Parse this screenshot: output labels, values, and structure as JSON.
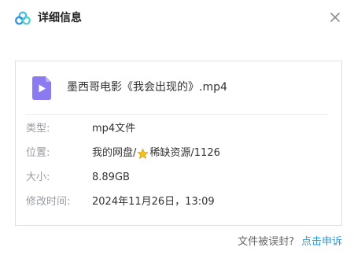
{
  "dialog": {
    "title": "详细信息"
  },
  "file": {
    "name": "墨西哥电影《我会出现的》.mp4",
    "icon": "video-file-icon"
  },
  "details": {
    "type_label": "类型:",
    "type_value": "mp4文件",
    "location_label": "位置:",
    "location_part1": "我的网盘/",
    "location_part2": "稀缺资源/1126",
    "size_label": "大小:",
    "size_value": "8.89GB",
    "modified_label": "修改时间:",
    "modified_value": "2024年11月26日，13:09"
  },
  "footer": {
    "report_text": "文件被误封?",
    "appeal_link": "点击申诉"
  },
  "colors": {
    "accent": "#2b9bd8",
    "file_icon": "#8a7cf0",
    "star": "#f5c21b"
  }
}
